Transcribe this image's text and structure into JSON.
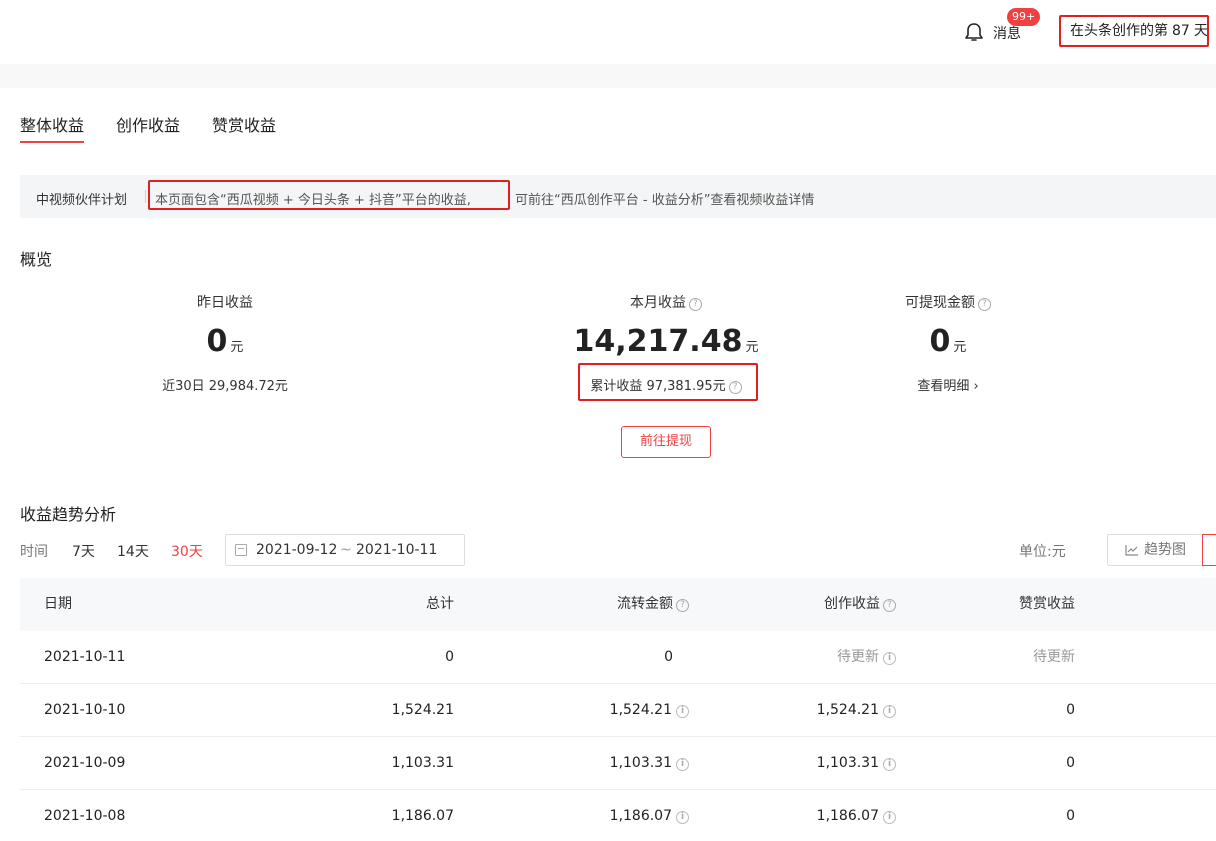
{
  "header": {
    "message_label": "消息",
    "message_badge": "99+",
    "days_prefix": "在头条创作的第",
    "days_count": "87",
    "days_suffix": "天"
  },
  "tabs": [
    "整体收益",
    "创作收益",
    "赞赏收益"
  ],
  "notice": {
    "tag": "中视频伙伴计划",
    "highlight": "本页面包含“西瓜视频 + 今日头条 + 抖音”平台的收益,",
    "rest": "可前往“西瓜创作平台 - 收益分析”查看视频收益详情"
  },
  "overview": {
    "title": "概览",
    "yesterday": {
      "label": "昨日收益",
      "value": "0",
      "unit": "元",
      "sub": "近30日 29,984.72元"
    },
    "month": {
      "label": "本月收益",
      "value": "14,217.48",
      "unit": "元",
      "sub": "累计收益 97,381.95元"
    },
    "withdrawable": {
      "label": "可提现金额",
      "value": "0",
      "unit": "元",
      "link": "查看明细",
      "link_arrow": "›"
    },
    "withdraw_button": "前往提现"
  },
  "trend": {
    "title": "收益趋势分析",
    "time_label": "时间",
    "ranges": [
      "7天",
      "14天",
      "30天"
    ],
    "active_range": "30天",
    "date_start": "2021-09-12",
    "date_sep": "~",
    "date_end": "2021-10-11",
    "unit_label": "单位:元",
    "chart_button": "趋势图"
  },
  "table": {
    "headers": [
      "日期",
      "总计",
      "流转金额",
      "创作收益",
      "赞赏收益"
    ],
    "rows": [
      {
        "date": "2021-10-11",
        "total": "0",
        "flow": "0",
        "create": "待更新",
        "reward": "待更新"
      },
      {
        "date": "2021-10-10",
        "total": "1,524.21",
        "flow": "1,524.21",
        "create": "1,524.21",
        "reward": "0"
      },
      {
        "date": "2021-10-09",
        "total": "1,103.31",
        "flow": "1,103.31",
        "create": "1,103.31",
        "reward": "0"
      },
      {
        "date": "2021-10-08",
        "total": "1,186.07",
        "flow": "1,186.07",
        "create": "1,186.07",
        "reward": "0"
      }
    ]
  },
  "colors": {
    "accent": "#f04142",
    "highlight_box": "#e02020"
  }
}
